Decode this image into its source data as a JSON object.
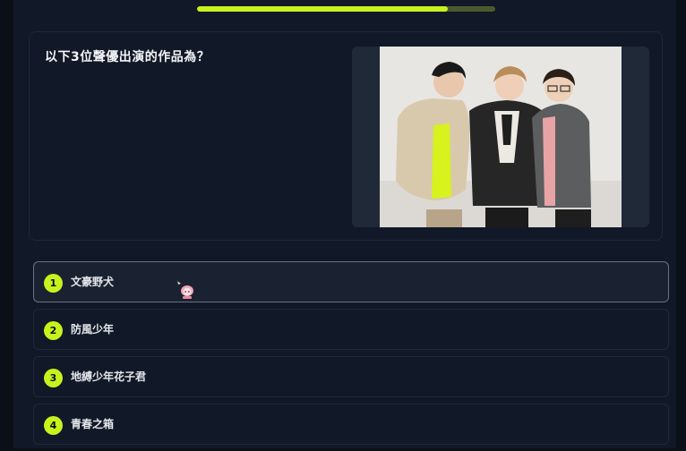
{
  "quiz": {
    "progress_fraction": 0.84,
    "question": "以下3位聲優出演的作品為？",
    "image_alt": "three voice actors photo",
    "options": [
      {
        "number": "1",
        "label": "文豪野犬"
      },
      {
        "number": "2",
        "label": "防風少年"
      },
      {
        "number": "3",
        "label": "地縛少年花子君"
      },
      {
        "number": "4",
        "label": "青春之箱"
      }
    ]
  },
  "colors": {
    "accent": "#c8f21c",
    "background": "#111827",
    "text": "#f3f4f6"
  }
}
